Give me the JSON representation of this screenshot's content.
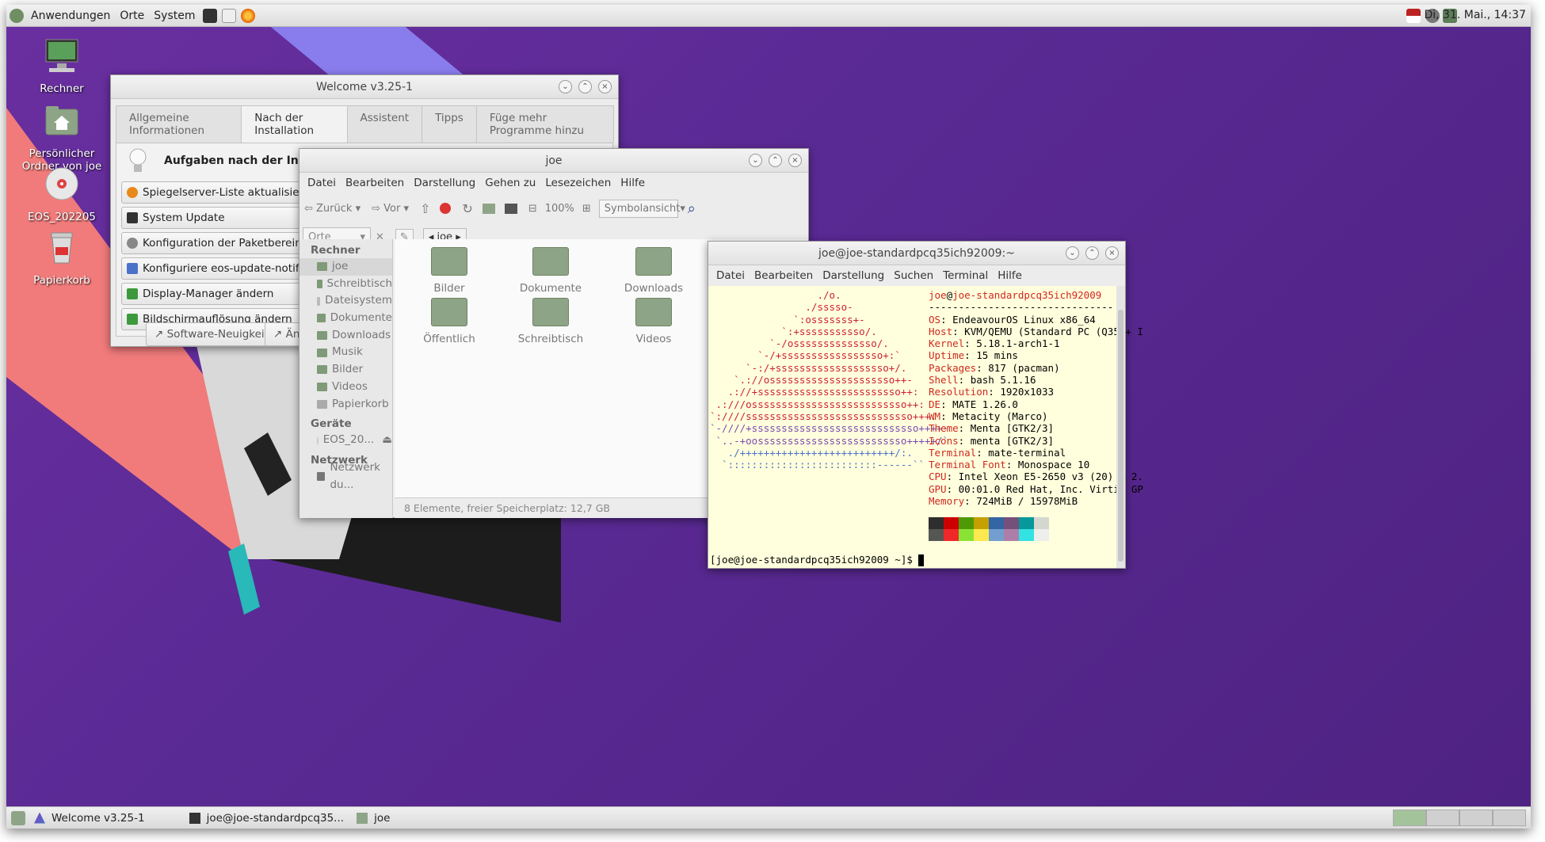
{
  "top_panel": {
    "menus": [
      "Anwendungen",
      "Orte",
      "System"
    ],
    "clock": "Di, 31. Mai., 14:37"
  },
  "desktop_icons": [
    {
      "label": "Rechner",
      "icon": "computer-icon"
    },
    {
      "label": "Persönlicher Ordner von joe",
      "icon": "home-folder-icon"
    },
    {
      "label": "EOS_202205",
      "icon": "optical-disc-icon"
    },
    {
      "label": "Papierkorb",
      "icon": "trash-icon"
    }
  ],
  "welcome": {
    "title": "Welcome v3.25-1",
    "tabs": [
      "Allgemeine Informationen",
      "Nach der Installation",
      "Assistent",
      "Tipps",
      "Füge mehr Programme hinzu"
    ],
    "active_tab": "Nach der Installation",
    "heading": "Aufgaben nach der Installation",
    "buttons": [
      "Spiegelserver-Liste aktualisieren",
      "System Update",
      "Konfiguration der Paketbereinigung",
      "Konfiguriere eos-update-notifier",
      "Display-Manager ändern",
      "Bildschirmauflösung ändern"
    ],
    "footer_buttons": [
      "Software-Neuigkeiten",
      "Änd"
    ]
  },
  "filemanager": {
    "title": "joe",
    "menu": [
      "Datei",
      "Bearbeiten",
      "Darstellung",
      "Gehen zu",
      "Lesezeichen",
      "Hilfe"
    ],
    "toolbar": {
      "back": "Zurück",
      "forward": "Vor",
      "zoom": "100%",
      "view": "Symbolansicht"
    },
    "location_combo": "Orte",
    "path": "joe",
    "sidebar": {
      "sections": [
        {
          "title": "Rechner",
          "items": [
            "joe",
            "Schreibtisch",
            "Dateisystem",
            "Dokumente",
            "Downloads",
            "Musik",
            "Bilder",
            "Videos",
            "Papierkorb"
          ]
        },
        {
          "title": "Geräte",
          "items": [
            "EOS_20..."
          ]
        },
        {
          "title": "Netzwerk",
          "items": [
            "Netzwerk du..."
          ]
        }
      ]
    },
    "folders": [
      "Bilder",
      "Dokumente",
      "Downloads",
      "Öffentlich",
      "Schreibtisch",
      "Videos"
    ],
    "status": "8 Elemente, freier Speicherplatz: 12,7 GB"
  },
  "terminal": {
    "title": "joe@joe-standardpcq35ich92009:~",
    "menu": [
      "Datei",
      "Bearbeiten",
      "Darstellung",
      "Suchen",
      "Terminal",
      "Hilfe"
    ],
    "user": "joe",
    "host": "joe-standardpcq35ich92009",
    "separator": "-------------------------------",
    "info": [
      {
        "key": "OS",
        "value": "EndeavourOS Linux x86_64"
      },
      {
        "key": "Host",
        "value": "KVM/QEMU (Standard PC (Q35 + I"
      },
      {
        "key": "Kernel",
        "value": "5.18.1-arch1-1"
      },
      {
        "key": "Uptime",
        "value": "15 mins"
      },
      {
        "key": "Packages",
        "value": "817 (pacman)"
      },
      {
        "key": "Shell",
        "value": "bash 5.1.16"
      },
      {
        "key": "Resolution",
        "value": "1920x1033"
      },
      {
        "key": "DE",
        "value": "MATE 1.26.0"
      },
      {
        "key": "WM",
        "value": "Metacity (Marco)"
      },
      {
        "key": "Theme",
        "value": "Menta [GTK2/3]"
      },
      {
        "key": "Icons",
        "value": "menta [GTK2/3]"
      },
      {
        "key": "Terminal",
        "value": "mate-terminal"
      },
      {
        "key": "Terminal Font",
        "value": "Monospace 10"
      },
      {
        "key": "CPU",
        "value": "Intel Xeon E5-2650 v3 (20) @ 2."
      },
      {
        "key": "GPU",
        "value": "00:01.0 Red Hat, Inc. Virtio GP"
      },
      {
        "key": "Memory",
        "value": "724MiB / 15978MiB"
      }
    ],
    "palette_top": [
      "#2e2e2e",
      "#cc0000",
      "#4e9a06",
      "#c4a000",
      "#3465a4",
      "#75507b",
      "#06989a",
      "#d3d7cf"
    ],
    "palette_bottom": [
      "#555753",
      "#ef2929",
      "#8ae234",
      "#fce94f",
      "#729fcf",
      "#ad7fa8",
      "#34e2e2",
      "#eeeeec"
    ],
    "prompt": "[joe@joe-standardpcq35ich92009 ~]$"
  },
  "taskbar": {
    "tasks": [
      "Welcome v3.25-1",
      "joe@joe-standardpcq35...",
      "joe"
    ]
  }
}
